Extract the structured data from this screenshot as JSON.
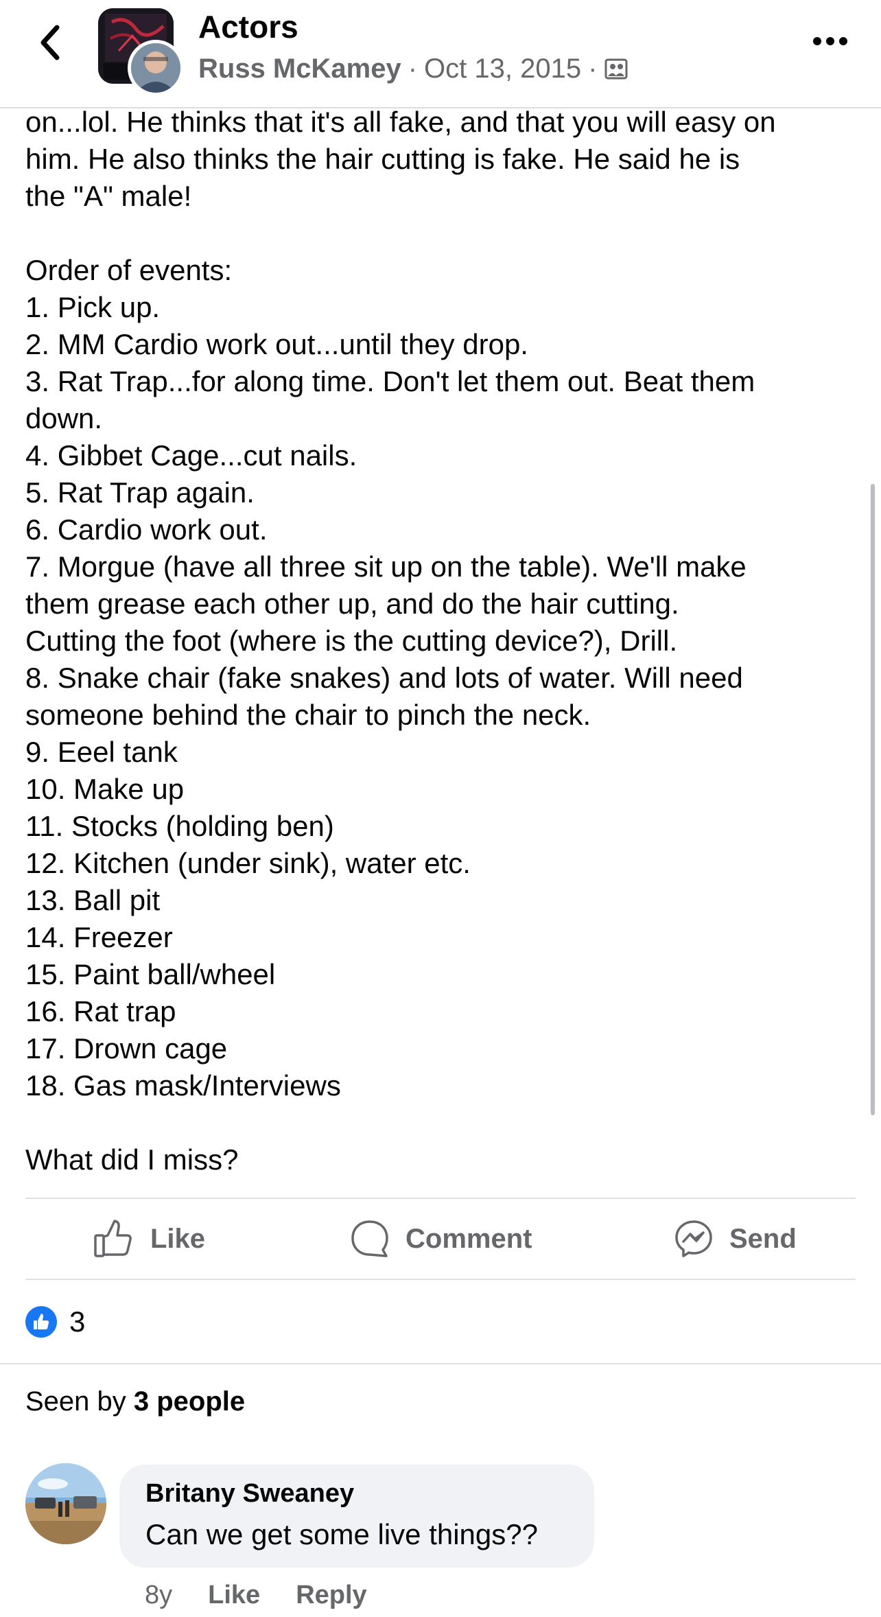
{
  "header": {
    "group_name": "Actors",
    "author": "Russ McKamey",
    "date": "Oct 13, 2015",
    "separator": "·",
    "back_icon": "chevron-left-icon",
    "more_icon": "ellipsis-horizontal-icon",
    "audience_icon": "group-members-icon"
  },
  "post": {
    "lines": [
      "on...lol. He thinks that it's all fake, and that you will easy on",
      "him. He also thinks the hair cutting is fake. He said he is",
      "the \"A\" male!",
      "",
      "Order of events:",
      "1. Pick up.",
      "2. MM Cardio work out...until they drop.",
      "3. Rat Trap...for along time. Don't let them out. Beat them",
      "down.",
      "4. Gibbet Cage...cut nails.",
      "5. Rat Trap again.",
      "6. Cardio work out.",
      "7. Morgue (have all three sit up on the table). We'll make",
      "them grease each other up, and do the hair cutting.",
      "Cutting the foot (where is the cutting device?), Drill.",
      "8. Snake chair (fake snakes) and lots of water. Will need",
      "someone behind the chair to pinch the neck.",
      "9. Eeel tank",
      "10. Make up",
      "11. Stocks (holding ben)",
      "12. Kitchen (under sink), water etc.",
      "13. Ball pit",
      "14. Freezer",
      "15. Paint ball/wheel",
      "16. Rat trap",
      "17. Drown cage",
      "18. Gas mask/Interviews",
      "",
      "What did I miss?"
    ]
  },
  "actions": {
    "like": "Like",
    "comment": "Comment",
    "send": "Send"
  },
  "reactions": {
    "count": "3",
    "icon": "thumbs-up-icon"
  },
  "seen": {
    "prefix": "Seen by ",
    "count_text": "3 people"
  },
  "comment": {
    "author": "Britany Sweaney",
    "text": "Can we get some live things??",
    "age": "8y",
    "like": "Like",
    "reply": "Reply"
  },
  "colors": {
    "brand_blue": "#1877f2",
    "secondary_text": "#65676b",
    "bubble_bg": "#f0f2f5"
  }
}
